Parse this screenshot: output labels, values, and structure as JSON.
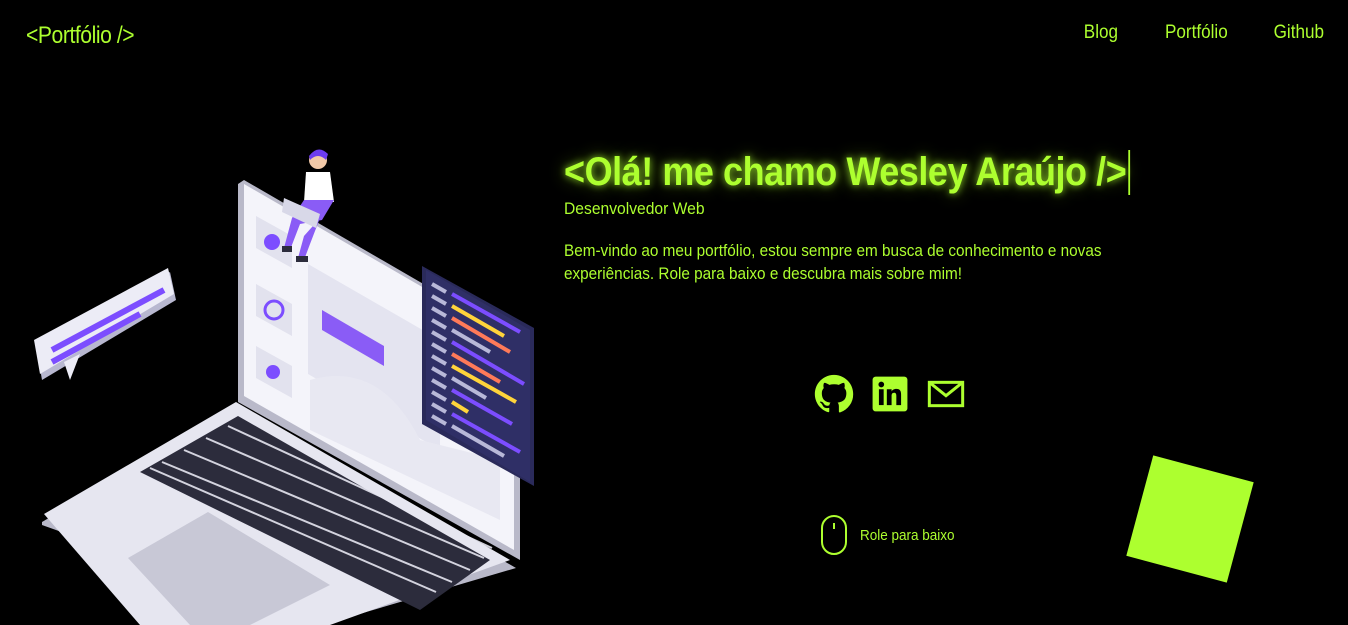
{
  "header": {
    "logo": "<Portfólio />",
    "nav": [
      "Blog",
      "Portfólio",
      "Github"
    ]
  },
  "hero": {
    "title": "<Olá! me chamo Wesley Araújo />",
    "subtitle": "Desenvolvedor Web",
    "description": "Bem-vindo ao meu portfólio, estou sempre em busca de conhecimento e novas experiências. Role para baixo e descubra mais sobre mim!"
  },
  "socials": [
    {
      "icon": "github-icon"
    },
    {
      "icon": "linkedin-icon"
    },
    {
      "icon": "mail-icon"
    }
  ],
  "scroll_hint": {
    "label": "Role para baixo",
    "icon": "mouse-icon"
  },
  "colors": {
    "accent": "#adff2f",
    "background": "#000000",
    "purple": "#7c4dff",
    "laptop": "#e4e4f0"
  }
}
